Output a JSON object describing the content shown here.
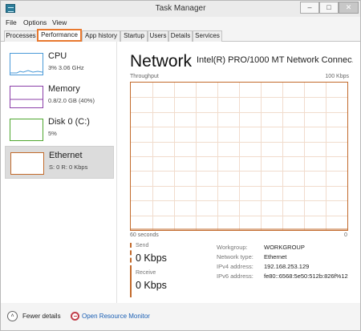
{
  "window": {
    "title": "Task Manager",
    "min_glyph": "–",
    "max_glyph": "□",
    "close_glyph": "✕"
  },
  "menu": [
    "File",
    "Options",
    "View"
  ],
  "tabs": [
    {
      "label": "Processes",
      "active": false
    },
    {
      "label": "Performance",
      "active": true
    },
    {
      "label": "App history",
      "active": false
    },
    {
      "label": "Startup",
      "active": false
    },
    {
      "label": "Users",
      "active": false
    },
    {
      "label": "Details",
      "active": false
    },
    {
      "label": "Services",
      "active": false
    }
  ],
  "sidebar": {
    "items": [
      {
        "name": "CPU",
        "value": "3% 3.06 GHz",
        "color": "#4a9ad8",
        "active": false
      },
      {
        "name": "Memory",
        "value": "0.8/2.0 GB (40%)",
        "color": "#8b3fa8",
        "active": false
      },
      {
        "name": "Disk 0 (C:)",
        "value": "5%",
        "color": "#4ea72e",
        "active": false
      },
      {
        "name": "Ethernet",
        "value": "S: 0 R: 0 Kbps",
        "color": "#c26a2b",
        "active": true
      }
    ]
  },
  "panel": {
    "title": "Network",
    "adapter": "Intel(R) PRO/1000 MT Network Connec...",
    "graph_label": "Throughput",
    "graph_max": "100 Kbps",
    "axis_left": "60 seconds",
    "axis_right": "0",
    "accent_color": "#c26a2b"
  },
  "stats": {
    "send_label": "Send",
    "send_value": "0 Kbps",
    "receive_label": "Receive",
    "receive_value": "0 Kbps"
  },
  "info": [
    {
      "label": "Workgroup:",
      "value": "WORKGROUP"
    },
    {
      "label": "Network type:",
      "value": "Ethernet"
    },
    {
      "label": "IPv4 address:",
      "value": "192.168.253.129"
    },
    {
      "label": "IPv6 address:",
      "value": "fe80::6568:5e50:512b:826f%12"
    }
  ],
  "footer": {
    "fewer_details": "Fewer details",
    "fewer_icon": "˄",
    "open_monitor": "Open Resource Monitor"
  },
  "chart_data": {
    "type": "line",
    "title": "Network",
    "xlabel": "",
    "ylabel": "Throughput",
    "x_range_label": [
      "60 seconds",
      "0"
    ],
    "ylim": [
      0,
      100
    ],
    "y_unit": "Kbps",
    "grid": true,
    "series": [
      {
        "values": [
          0,
          0,
          0,
          0,
          0,
          0,
          0,
          0,
          0,
          0,
          0,
          0,
          0,
          0,
          0,
          0,
          0,
          0,
          0,
          0,
          0,
          0,
          0,
          0,
          0,
          0,
          0,
          0,
          0,
          0,
          0,
          0,
          0,
          0,
          0,
          0,
          0,
          0,
          0,
          0,
          0,
          0,
          0,
          0,
          0,
          0,
          0,
          0,
          0,
          0,
          0,
          0,
          0,
          0,
          0,
          0,
          0,
          0,
          0,
          0,
          0
        ]
      }
    ]
  }
}
